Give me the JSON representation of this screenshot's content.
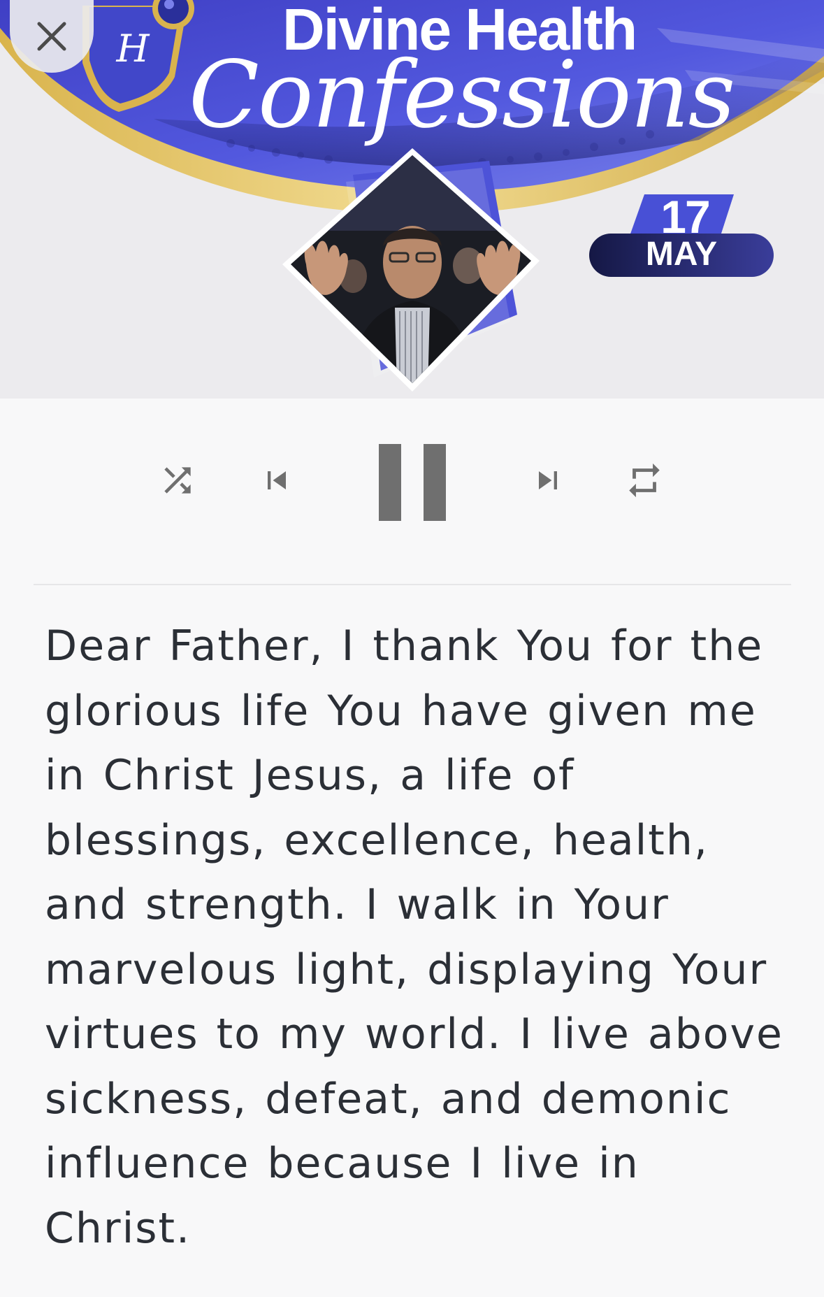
{
  "banner": {
    "title": "Divine Health",
    "script_title": "Confessions",
    "logo_letter": "H",
    "date": {
      "day": "17",
      "month": "MAY"
    },
    "colors": {
      "primary_blue": "#4a4fd6",
      "gold_arc": "#e3c46a",
      "date_pill": "#1f2160"
    }
  },
  "close_button": {
    "icon": "close-icon"
  },
  "player_controls": {
    "shuffle": {
      "icon": "shuffle-icon"
    },
    "previous": {
      "icon": "skip-previous-icon"
    },
    "play_pause": {
      "icon": "pause-icon",
      "state": "playing"
    },
    "next": {
      "icon": "skip-next-icon"
    },
    "repeat": {
      "icon": "repeat-icon"
    },
    "icon_color": "#6f6f6f"
  },
  "confession_text": "Dear Father, I thank You for the glorious life You have given me in Christ Jesus, a life of blessings, excellence, health, and strength. I walk in Your marvelous light, displaying Your virtues to my world. I live above sickness, defeat, and demonic influence because I live in Christ."
}
